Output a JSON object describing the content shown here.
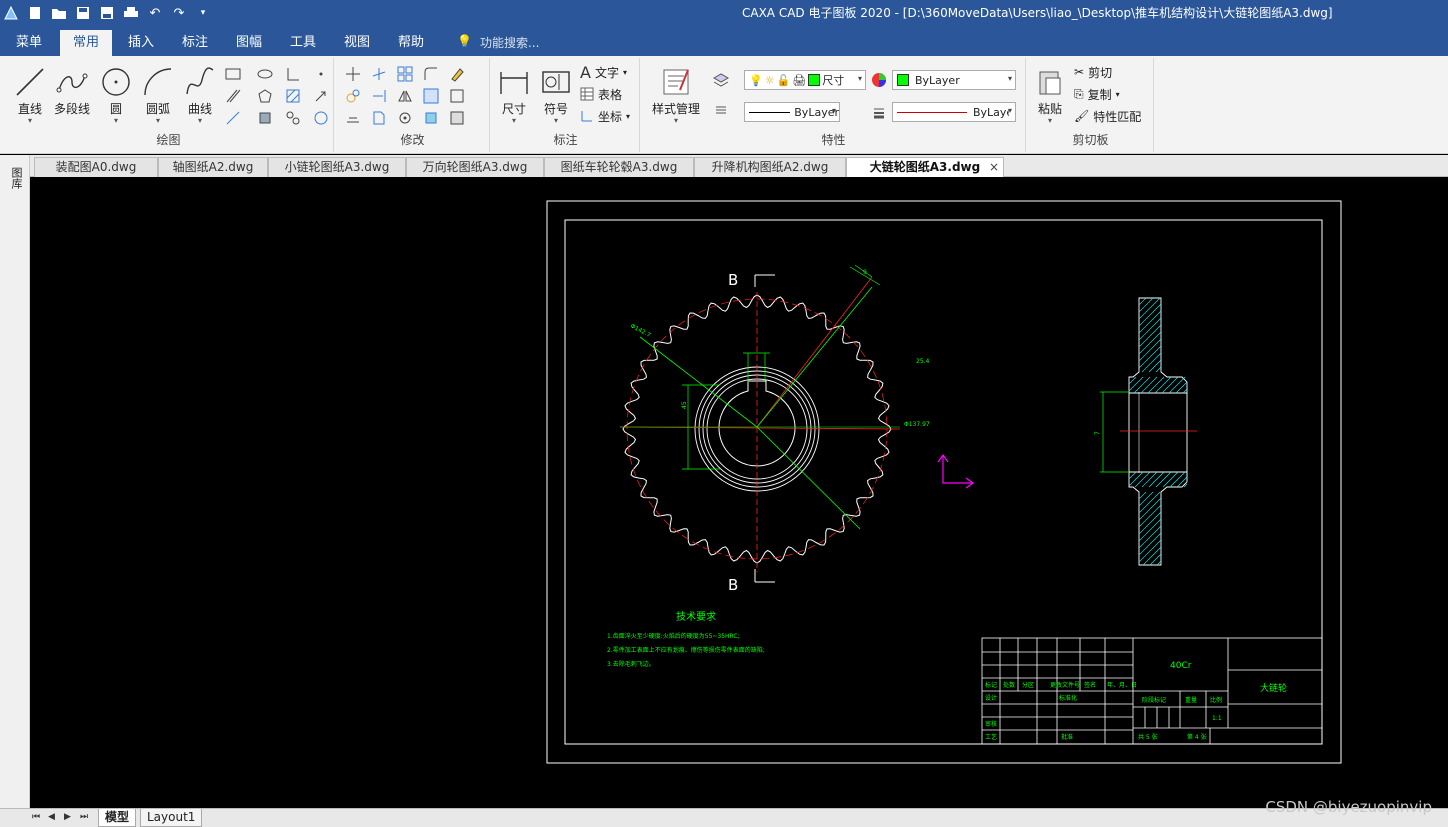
{
  "titlebar": {
    "title": "CAXA CAD 电子图板 2020 - [D:\\360MoveData\\Users\\liao_\\Desktop\\推车机结构设计\\大链轮图纸A3.dwg]"
  },
  "menu": {
    "tabs": [
      "菜单",
      "常用",
      "插入",
      "标注",
      "图幅",
      "工具",
      "视图",
      "帮助"
    ],
    "active": "常用",
    "search_placeholder": "功能搜索..."
  },
  "ribbon": {
    "draw": {
      "label": "绘图",
      "line": "直线",
      "polyline": "多段线",
      "circle": "圆",
      "arc": "圆弧",
      "curve": "曲线"
    },
    "modify": {
      "label": "修改"
    },
    "dimension": {
      "label": "标注",
      "dim": "尺寸",
      "symbol": "符号",
      "text": "文字",
      "table": "表格",
      "coordinate": "坐标"
    },
    "properties": {
      "label": "特性",
      "style_manager": "样式管理",
      "dim_style": "尺寸",
      "color_value": "ByLayer",
      "linetype_value": "ByLayer",
      "lineweight_value": "ByLayer"
    },
    "clipboard": {
      "label": "剪切板",
      "paste": "粘贴",
      "cut": "剪切",
      "copy": "复制",
      "match": "特性匹配"
    }
  },
  "leftstrip": {
    "label": "图库"
  },
  "doc_tabs": [
    "装配图A0.dwg",
    "轴图纸A2.dwg",
    "小链轮图纸A3.dwg",
    "万向轮图纸A3.dwg",
    "图纸车轮轮毂A3.dwg",
    "升降机构图纸A2.dwg",
    "大链轮图纸A3.dwg"
  ],
  "doc_tab_active": "大链轮图纸A3.dwg",
  "drawing": {
    "section_label_top": "B",
    "section_label_bottom": "B",
    "dim_diameter_outer": "Φ142.7",
    "dim_pitch": "25.4",
    "dim_root": "Φ137.97",
    "dim_r": "9",
    "dim_bore": "45",
    "dim_side": "7",
    "tech_title": "技术要求",
    "tech_lines": [
      "1.齿面淬火至少硬度:火焰后的硬度为55~35HRC;",
      "2.零件加工表面上不应有划痕、擦伤等损伤零件表面的缺陷;",
      "3.去除毛刺飞边。"
    ],
    "material": "40Cr",
    "part_name": "大链轮",
    "tb_row1": [
      "标记",
      "处数",
      "分区",
      "更改文件号",
      "签名",
      "年、月、日"
    ],
    "tb_design": "设计",
    "tb_standard": "标准化",
    "tb_review": "审核",
    "tb_process": "工艺",
    "tb_approve": "批准",
    "tb_stage": "阶段标记",
    "tb_weight": "重量",
    "tb_scale": "比例",
    "tb_scale_value": "1:1",
    "tb_sheets": "共 5 张",
    "tb_sheet_no": "第 4 张"
  },
  "bottom": {
    "tabs": [
      "模型",
      "Layout1"
    ],
    "active": "模型"
  },
  "watermark": "CSDN @biyezuopinvip",
  "colors": {
    "accent": "#2b579a",
    "drawing_green": "#00ff00",
    "drawing_white": "#ffffff",
    "drawing_red": "#ff0000",
    "drawing_magenta": "#ff00ff",
    "drawing_cyan": "#00ffff",
    "drawing_yellow": "#ffff00"
  }
}
